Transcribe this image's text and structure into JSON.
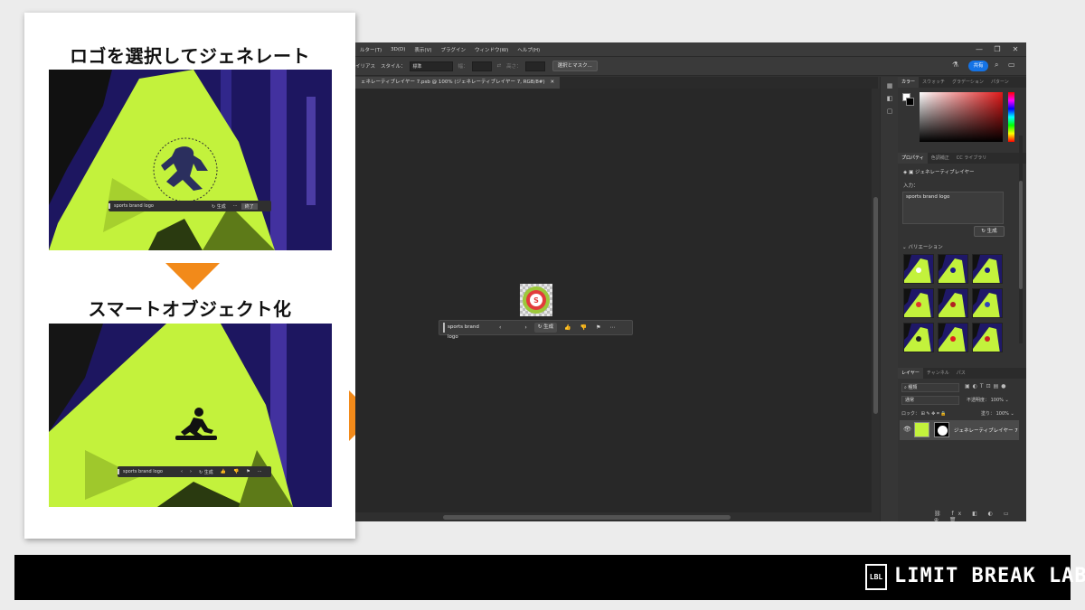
{
  "left_card": {
    "title_top": "ロゴを選択してジェネレート",
    "title_bottom": "スマートオブジェクト化",
    "top_bar": {
      "prompt": "sports brand logo",
      "generate": "生成",
      "more": "⋯",
      "done": "終了"
    },
    "bottom_bar": {
      "prompt": "sports brand logo",
      "prev": "‹",
      "next": "›",
      "generate": "生成",
      "more": "⋯"
    }
  },
  "photoshop": {
    "menu": [
      "ルター(T)",
      "3D(D)",
      "表示(V)",
      "プラグイン",
      "ウィンドウ(W)",
      "ヘルプ(H)"
    ],
    "window_controls": [
      "—",
      "❐",
      "✕"
    ],
    "options": {
      "antialias": "イリアス",
      "style_label": "スタイル：",
      "style_value": "標準",
      "width_label": "幅：",
      "height_label": "高さ：",
      "select_mask": "選択とマスク..."
    },
    "share": "共有",
    "doc_tab": "ェネレーティブレイヤー 7.psb @ 100% (ジェネレーティブレイヤー 7, RGB/8#)",
    "doc_tab_close": "✕",
    "gen_bar": {
      "prompt": "sports brand logo",
      "prev": "‹",
      "next": "›",
      "generate": "生成",
      "more": "⋯"
    },
    "color_tabs": [
      "カラー",
      "スウォッチ",
      "グラデーション",
      "パターン"
    ],
    "prop_tabs": [
      "プロパティ",
      "色調補正",
      "CC ライブラリ"
    ],
    "prop_layer_name": "ジェネレーティブレイヤー",
    "input_label": "入力：",
    "input_value": "sports brand logo",
    "generate_button": "生成",
    "variations_label": "バリエーション",
    "layer_tabs": [
      "レイヤー",
      "チャンネル",
      "パス"
    ],
    "layer_search": "種類",
    "blend_mode": "通常",
    "opacity_label": "不透明度：",
    "opacity_value": "100%",
    "lock_label": "ロック：",
    "fill_label": "塗り：",
    "fill_value": "100%",
    "layer_name": "ジェネレーティブレイヤー 7"
  },
  "brand": {
    "mark": "LBL",
    "name": "LIMIT BREAK LAB."
  },
  "colors": {
    "accent": "#f28a1a",
    "lime": "#c3f23c",
    "navy": "#1d1660",
    "ps_blue": "#1473e6"
  }
}
